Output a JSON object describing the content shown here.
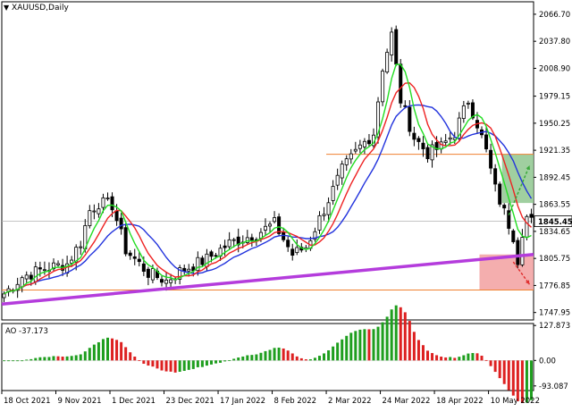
{
  "window": {
    "symbol_title": "XAUUSD,Daily",
    "title_icon": "triangle-down-icon"
  },
  "chart_data": [
    {
      "type": "candlestick",
      "title": "XAUUSD,Daily",
      "y_ticks": [
        "2066.70",
        "2037.80",
        "2008.90",
        "1979.15",
        "1950.25",
        "1921.35",
        "1892.45",
        "1863.55",
        "1834.65",
        "1805.75",
        "1776.85",
        "1747.95"
      ],
      "y_tick_values": [
        2066.7,
        2037.8,
        2008.9,
        1979.15,
        1950.25,
        1921.35,
        1892.45,
        1863.55,
        1834.65,
        1805.75,
        1776.85,
        1747.95
      ],
      "ylim": [
        1740,
        2080
      ],
      "x_ticks": [
        "18 Oct 2021",
        "9 Nov 2021",
        "1 Dec 2021",
        "23 Dec 2021",
        "17 Jan 2022",
        "8 Feb 2022",
        "2 Mar 2022",
        "24 Mar 2022",
        "18 Apr 2022",
        "10 May 2022"
      ],
      "current_price": "1845.45",
      "current_price_value": 1845.45,
      "lines": [
        {
          "name": "trendline-support",
          "color": "#b43cdc",
          "points": [
            [
              0,
              1757
            ],
            [
              117,
              1810
            ]
          ]
        },
        {
          "name": "resistance-level",
          "color": "#f08030",
          "points": [
            [
              72,
              1917
            ],
            [
              117,
              1917
            ]
          ]
        },
        {
          "name": "support-level",
          "color": "#f08030",
          "points": [
            [
              0,
              1772
            ],
            [
              117,
              1772
            ]
          ]
        }
      ],
      "zones": [
        {
          "name": "bullish-target-zone",
          "color": "#8fc78f",
          "x": [
            111,
            117
          ],
          "y": [
            1865,
            1917
          ]
        },
        {
          "name": "bearish-target-zone",
          "color": "#f2a0a0",
          "x": [
            106,
            117
          ],
          "y": [
            1772,
            1810
          ]
        }
      ],
      "arrows": [
        {
          "name": "up-forecast-arrow",
          "color": "#3aa83a",
          "from": [
            112,
            1852
          ],
          "to": [
            117,
            1905
          ]
        },
        {
          "name": "down-forecast-arrow",
          "color": "#e03030",
          "from": [
            113,
            1802
          ],
          "to": [
            117,
            1778
          ]
        }
      ],
      "ma_colors": {
        "fast": "#22dd22",
        "medium": "#ee2222",
        "slow": "#2233dd"
      }
    },
    {
      "type": "bar",
      "title": "AO -37.173",
      "indicator_label": "AO -37.173",
      "y_ticks": [
        "127.873",
        "0.00",
        "-93.087"
      ],
      "y_tick_values": [
        127.873,
        0,
        -93.087
      ],
      "ylim": [
        -110,
        135
      ],
      "colors": {
        "up": "#1e9e1e",
        "down": "#dd2020"
      }
    }
  ]
}
